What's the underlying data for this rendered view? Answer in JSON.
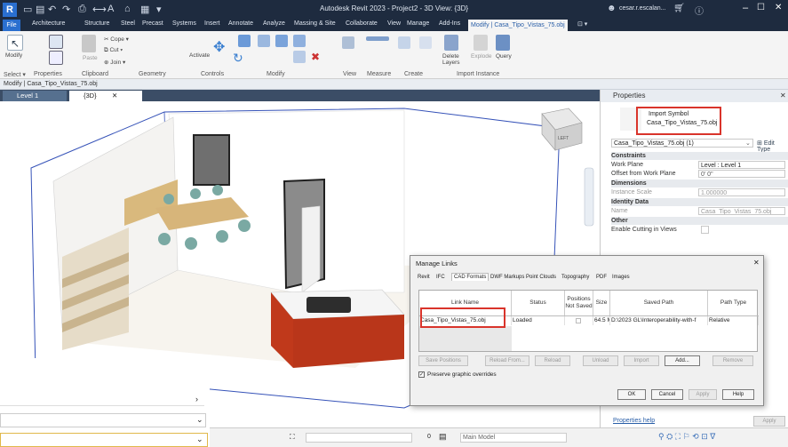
{
  "app": {
    "title": "Autodesk Revit 2023 - Project2 - 3D View: {3D}",
    "user": "cesar.r.escalan...",
    "window_controls": [
      "–",
      "☐",
      "✕"
    ]
  },
  "menu": {
    "file": "File",
    "tabs": [
      "Architecture",
      "Structure",
      "Steel",
      "Precast",
      "Systems",
      "Insert",
      "Annotate",
      "Analyze",
      "Massing & Site",
      "Collaborate",
      "View",
      "Manage",
      "Add-Ins"
    ],
    "active_tab": "Modify | Casa_Tipo_Vistas_75.obj"
  },
  "ribbon": {
    "modify_label": "Modify",
    "cope": "Cope",
    "cut": "Cut",
    "join": "Join",
    "paste": "Paste",
    "activate": "Activate",
    "delete_layers": "Delete Layers",
    "explode": "Explode",
    "query": "Query",
    "panels": {
      "select": "Select ▾",
      "properties": "Properties",
      "clipboard": "Clipboard",
      "geometry": "Geometry",
      "controls": "Controls",
      "modify": "Modify",
      "view": "View",
      "measure": "Measure",
      "create": "Create",
      "import_instance": "Import Instance"
    }
  },
  "options_bar": "Modify | Casa_Tipo_Vistas_75.obj",
  "view_tabs": {
    "level": "Level 1",
    "view3d": "{3D}",
    "close": "✕"
  },
  "viewcube": {
    "label": "LEFT"
  },
  "properties": {
    "header": "Properties",
    "symbol_line1": "Import Symbol",
    "symbol_line2": "Casa_Tipo_Vistas_75.obj",
    "selector": "Casa_Tipo_Vistas_75.obj (1)",
    "edit_type": "Edit Type",
    "groups": {
      "constraints": "Constraints",
      "dimensions": "Dimensions",
      "identity": "Identity Data",
      "other": "Other"
    },
    "rows": {
      "work_plane": {
        "label": "Work Plane",
        "value": "Level : Level 1"
      },
      "offset": {
        "label": "Offset from Work Plane",
        "value": "0' 0\""
      },
      "scale": {
        "label": "Instance Scale",
        "value": "1.000000"
      },
      "name": {
        "label": "Name",
        "value": "Casa_Tipo_Vistas_75.obj"
      },
      "cutting": {
        "label": "Enable Cutting in Views",
        "value": ""
      }
    },
    "help_link": "Properties help",
    "apply": "Apply"
  },
  "dialog": {
    "title": "Manage Links",
    "close": "✕",
    "tabs": [
      "Revit",
      "IFC",
      "CAD Formats",
      "DWF Markups",
      "Point Clouds",
      "Topography",
      "PDF",
      "Images"
    ],
    "active_tab": "CAD Formats",
    "columns": {
      "link_name": "Link Name",
      "status": "Status",
      "positions": "Positions Not Saved",
      "size": "Size",
      "saved_path": "Saved Path",
      "path_type": "Path Type"
    },
    "row": {
      "link_name": "Casa_Tipo_Vistas_75.obj",
      "status": "Loaded",
      "size": "64.5 M",
      "saved_path": "D:\\2023 GL\\Interoperability-with-f",
      "path_type": "Relative"
    },
    "buttons": {
      "save_positions": "Save Positions",
      "reload_from": "Reload From...",
      "reload": "Reload",
      "unload": "Unload",
      "import": "Import",
      "add": "Add...",
      "remove": "Remove",
      "ok": "OK",
      "cancel": "Cancel",
      "apply": "Apply",
      "help": "Help"
    },
    "preserve_overrides": "Preserve graphic overrides"
  },
  "statusbar": {
    "zero": "0",
    "model": "Main Model"
  },
  "colors": {
    "titlebar": "#1e2b3f",
    "accent": "#2a6fcf",
    "highlight_box": "#d9342b",
    "cabinet": "#c0391b"
  }
}
